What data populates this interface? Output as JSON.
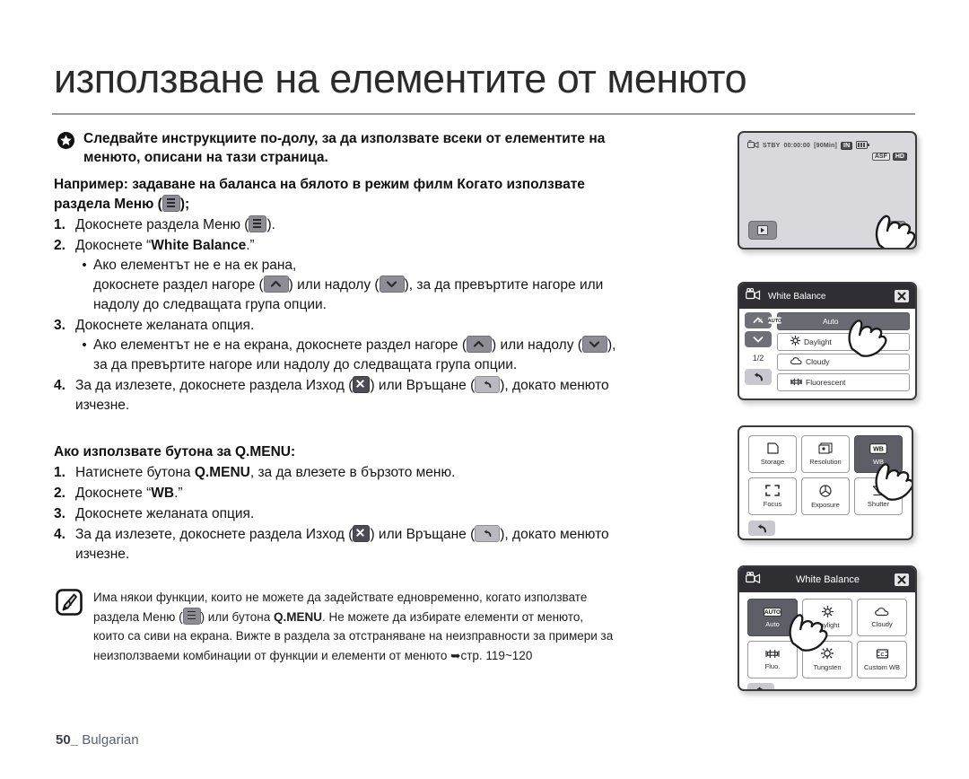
{
  "page": {
    "title": "използване на елементите от менюто",
    "footer_page": "50_",
    "footer_lang": "Bulgarian"
  },
  "intro": {
    "bullet_icon": "star-icon",
    "line1": "Следвайте инструкциите по-долу, за да използвате всеки от елементите на",
    "line2": "менюто, описани на тази страница."
  },
  "example": {
    "line1": "Например: задаване на баланса на бялото в режим филм Когато използвате",
    "line2_prefix": "раздела Меню (",
    "line2_suffix": ");",
    "menu_icon": "menu-tab-icon"
  },
  "menu_steps": [
    {
      "num": "1.",
      "text_before": "Докоснете раздела Меню (",
      "icon": "menu-tab-icon",
      "text_after": ")."
    },
    {
      "num": "2.",
      "text_before": "Докоснете “",
      "bold": "White Balance",
      "text_after": ".”"
    },
    {
      "num": "3.",
      "text": "Докоснете желаната опция."
    },
    {
      "num": "4.",
      "text_before": "За да излезете, докоснете раздела Изход (",
      "icon1": "exit-icon",
      "text_mid": ") или Връщане (",
      "icon2": "return-icon",
      "text_after": "), докато менюто",
      "text_line2": "изчезне."
    }
  ],
  "menu_bullets": [
    {
      "marker": "•",
      "l1": "Ако елементът не е на ек рана,",
      "l2_a": "докоснете раздел нагоре (",
      "icon_up": "chevron-up-icon",
      "l2_b": ") или надолу (",
      "icon_down": "chevron-down-icon",
      "l2_c": "), за да превъртите нагоре или",
      "l3": "надолу до следващата група опции."
    },
    {
      "marker": "•",
      "l1_a": "Ако елементът не е на екрана, докоснете раздел нагоре (",
      "icon_up": "chevron-up-icon",
      "l1_b": ") или надолу (",
      "icon_down": "chevron-down-icon",
      "l1_c": "),",
      "l2": "за да превъртите нагоре или надолу до следващата група опции."
    }
  ],
  "qmenu": {
    "heading": "Ако използвате бутона за Q.MENU:",
    "steps": [
      {
        "num": "1.",
        "text_before": "Натиснете бутона ",
        "bold": "Q.MENU",
        "text_after": ", за да влезете в бързото меню."
      },
      {
        "num": "2.",
        "text_before": "Докоснете “",
        "bold": "WB",
        "text_after": ".”"
      },
      {
        "num": "3.",
        "text": "Докоснете желаната опция."
      },
      {
        "num": "4.",
        "text_before": "За да излезете, докоснете раздела Изход (",
        "icon1": "exit-icon",
        "text_mid": ") или Връщане (",
        "icon2": "return-icon",
        "text_after": "), докато менюто",
        "text_line2": "изчезне."
      }
    ]
  },
  "note": {
    "icon": "note-pen-icon",
    "l1": "Има някои функции, които не можете да задействате едновременно, когато използвате",
    "l2_a": "раздела Меню (",
    "l2_icon": "menu-tab-icon",
    "l2_b": ") или бутона ",
    "l2_bold": "Q.MENU",
    "l2_c": ". Не можете да избирате елементи от менюто,",
    "l3": "които са сиви на екрана. Вижте в раздела за отстраняване на неизправности за примери за",
    "l4_a": "неизползваеми комбинации от функции и елементи от менюто ",
    "l4_arrow": "➥",
    "l4_b": "стр. 119~120"
  },
  "screens": {
    "standby": {
      "name": "standby-screen",
      "mode_icon": "camcorder-icon",
      "status": "STBY",
      "timecode": "00:00:00",
      "remaining": "[90Min]",
      "storage_tag": "IN",
      "battery_icon": "battery-icon",
      "tag_anti_shake": "ASF",
      "tag_quality": "HD",
      "play_button": "play-tab-icon",
      "menu_button": "menu-tab-icon",
      "hand": "finger-cursor"
    },
    "wb_list": {
      "name": "white-balance-list-screen",
      "header_icon": "camcorder-icon",
      "title": "White Balance",
      "close": "close-icon",
      "up": "chevron-up-icon",
      "down": "chevron-down-icon",
      "page": "1/2",
      "back": "return-icon",
      "options": [
        {
          "label": "Auto",
          "icon": "auto-icon",
          "selected": true,
          "check": "✓"
        },
        {
          "label": "Daylight",
          "icon": "sun-icon",
          "selected": false
        },
        {
          "label": "Cloudy",
          "icon": "cloud-icon",
          "selected": false
        },
        {
          "label": "Fluorescent",
          "icon": "fluorescent-icon",
          "selected": false
        }
      ],
      "hand": "finger-cursor"
    },
    "qmenu_grid": {
      "name": "quick-menu-grid-screen",
      "back": "return-icon",
      "items": [
        {
          "label": "Storage",
          "icon": "memory-card-icon",
          "selected": false
        },
        {
          "label": "Resolution",
          "icon": "resolution-icon",
          "selected": false
        },
        {
          "label": "WB",
          "icon": "wb-icon",
          "selected": true
        },
        {
          "label": "Focus",
          "icon": "focus-brackets-icon",
          "selected": false
        },
        {
          "label": "Exposure",
          "icon": "aperture-icon",
          "selected": false
        },
        {
          "label": "Shutter",
          "icon": "shutter-icon",
          "selected": false
        }
      ],
      "hand": "finger-cursor"
    },
    "wb_grid": {
      "name": "white-balance-grid-screen",
      "header_icon": "camcorder-icon",
      "title": "White Balance",
      "close": "close-icon",
      "back": "return-icon",
      "items": [
        {
          "label": "Auto",
          "icon": "auto-icon",
          "selected": true
        },
        {
          "label": "Daylight",
          "icon": "sun-icon",
          "selected": false
        },
        {
          "label": "Cloudy",
          "icon": "cloud-icon",
          "selected": false
        },
        {
          "label": "Fluo.",
          "icon": "fluorescent-icon",
          "selected": false
        },
        {
          "label": "Tungsten",
          "icon": "tungsten-icon",
          "selected": false
        },
        {
          "label": "Custom WB",
          "icon": "custom-wb-icon",
          "selected": false
        }
      ],
      "hand": "finger-cursor"
    }
  }
}
